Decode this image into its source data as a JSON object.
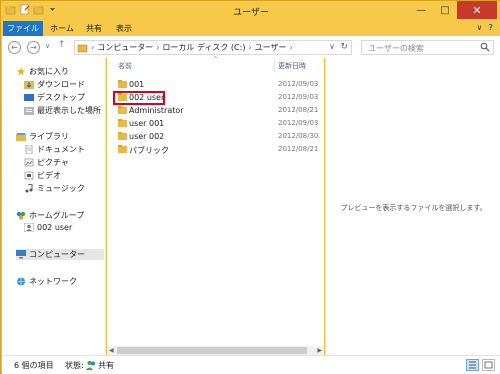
{
  "window": {
    "title": "ユーザー",
    "minimize": "—",
    "maximize": "□",
    "close": "✕"
  },
  "ribbon": {
    "tabs": [
      "ファイル",
      "ホーム",
      "共有",
      "表示"
    ],
    "expand": "∨",
    "help": "?"
  },
  "address": {
    "back": "←",
    "forward": "→",
    "recent": "∨",
    "up": "↑",
    "breadcrumbs": [
      "コンピューター",
      "ローカル ディスク (C:)",
      "ユーザー"
    ],
    "dropdown": "∨",
    "refresh": "↻",
    "search_placeholder": "ユーザーの検索"
  },
  "nav_pane": {
    "favorites": "お気に入り",
    "downloads": "ダウンロード",
    "desktop": "デスクトップ",
    "recent_places": "最近表示した場所",
    "libraries": "ライブラリ",
    "documents": "ドキュメント",
    "pictures": "ピクチャ",
    "videos": "ビデオ",
    "music": "ミュージック",
    "homegroup": "ホームグループ",
    "homegroup_user": "002 user",
    "computer": "コンピューター",
    "network": "ネットワーク"
  },
  "file_list": {
    "col_name": "名前",
    "col_date": "更新日時",
    "sort_indicator": "^",
    "rows": [
      {
        "name": "001",
        "date": "2012/09/03"
      },
      {
        "name": "002 user",
        "date": "2012/09/03"
      },
      {
        "name": "Administrator",
        "date": "2012/08/21"
      },
      {
        "name": "user 001",
        "date": "2012/09/03"
      },
      {
        "name": "user 002",
        "date": "2012/08/30"
      },
      {
        "name": "パブリック",
        "date": "2012/08/21"
      }
    ]
  },
  "preview": {
    "message": "プレビューを表示するファイルを選択します。"
  },
  "status_bar": {
    "item_count": "6 個の項目",
    "state_label": "状態:",
    "state_value": "共有"
  },
  "colors": {
    "title_bar": "#f6c948",
    "file_tab": "#1c76c9",
    "close_button": "#c7392b",
    "highlight_box": "#e0001b",
    "folder": "#e8b948"
  }
}
